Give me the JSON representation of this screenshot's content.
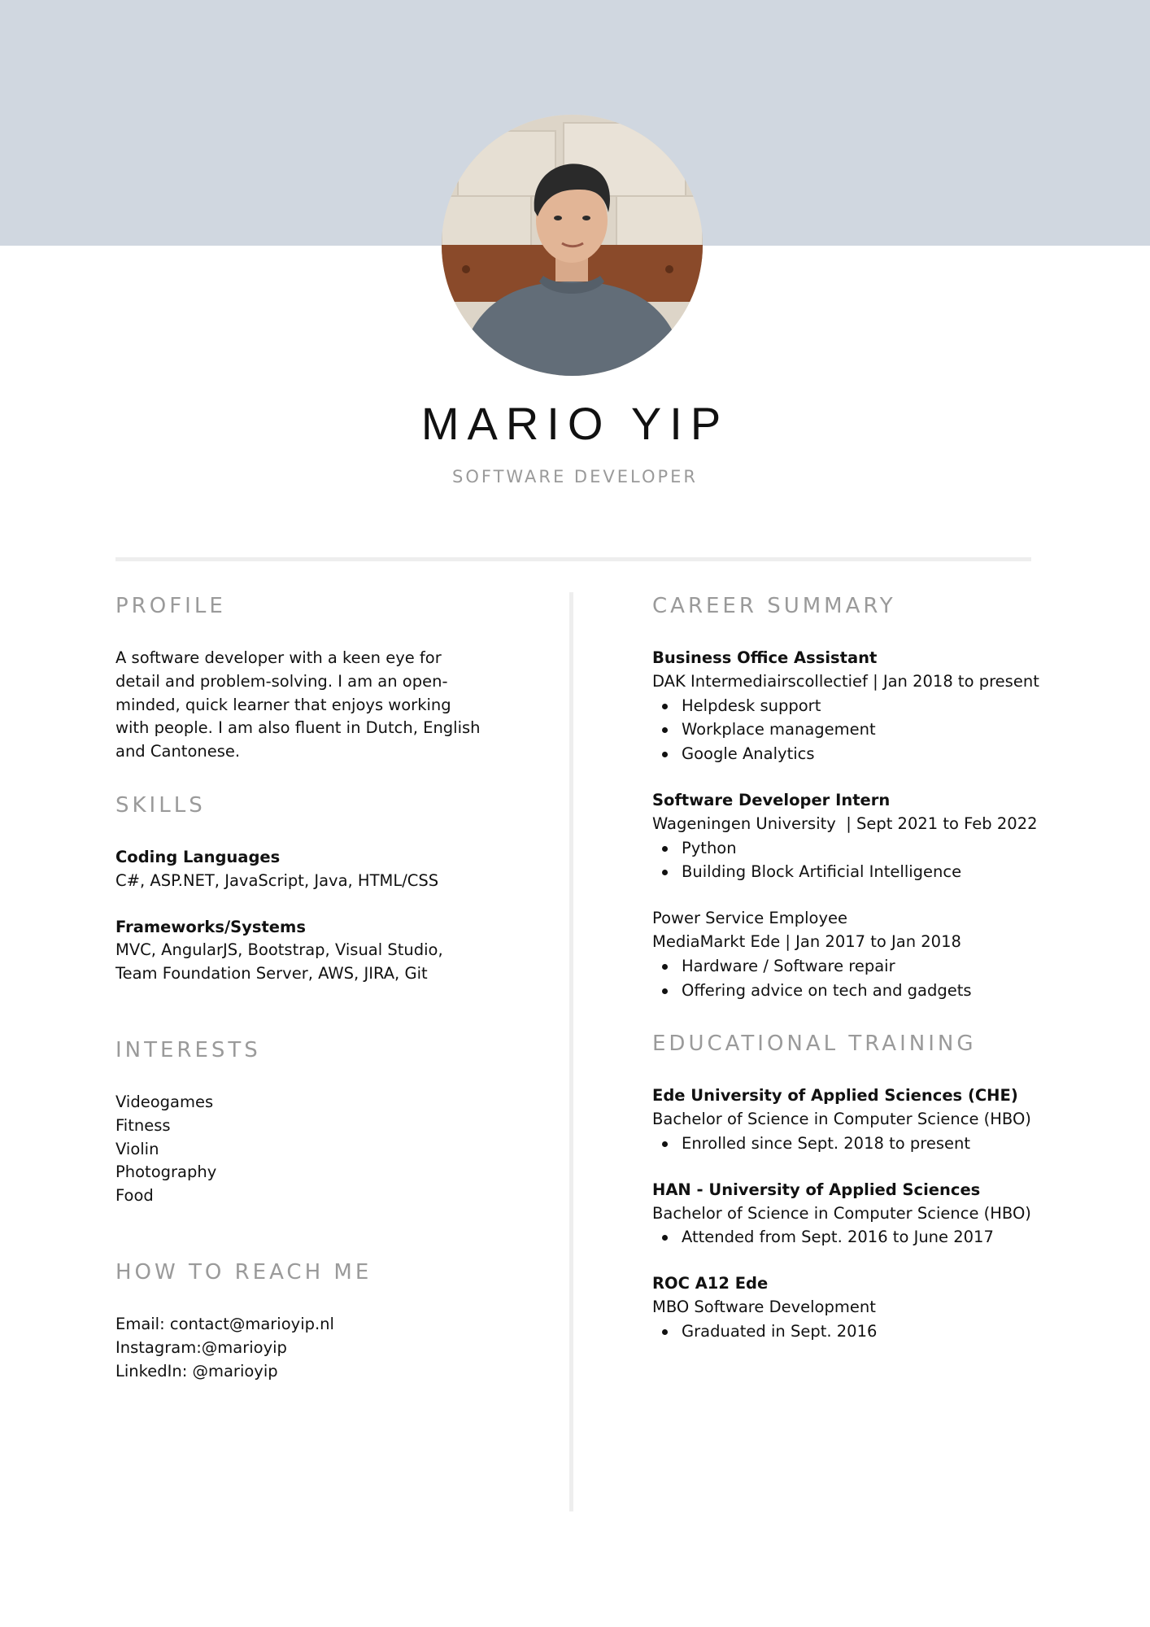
{
  "header": {
    "name": "MARIO YIP",
    "role": "SOFTWARE DEVELOPER",
    "band_color": "#d0d7e0"
  },
  "profile": {
    "title": "PROFILE",
    "lines": [
      "A software developer with a keen eye for",
      "detail and problem-solving. I am an open-",
      "minded, quick learner that enjoys working",
      "with people. I am also fluent in Dutch, English",
      "and Cantonese."
    ]
  },
  "skills": {
    "title": "SKILLS",
    "groups": [
      {
        "heading": "Coding Languages",
        "lines": [
          "C#, ASP.NET, JavaScript, Java, HTML/CSS"
        ]
      },
      {
        "heading": "Frameworks/Systems",
        "lines": [
          "MVC, AngularJS, Bootstrap, Visual Studio,",
          "Team Foundation Server, AWS, JIRA, Git"
        ]
      }
    ]
  },
  "interests": {
    "title": "INTERESTS",
    "items": [
      "Videogames",
      "Fitness",
      "Violin",
      "Photography",
      "Food"
    ]
  },
  "contact": {
    "title": "HOW TO REACH ME",
    "items": [
      "Email: contact@marioyip.nl",
      "Instagram:@marioyip",
      "LinkedIn: @marioyip"
    ]
  },
  "career": {
    "title": "CAREER SUMMARY",
    "jobs": [
      {
        "title": "Business Office Assistant",
        "company": "DAK Intermediairscollectief | Jan 2018 to present",
        "bullets": [
          "Helpdesk support",
          "Workplace management",
          "Google Analytics"
        ]
      },
      {
        "title": "Software Developer Intern",
        "company": "Wageningen University  | Sept 2021 to Feb 2022",
        "bullets": [
          "Python",
          "Building Block Artificial Intelligence"
        ]
      },
      {
        "title": "Power Service Employee",
        "company": "MediaMarkt Ede | Jan 2017 to Jan 2018",
        "bullets": [
          "Hardware / Software repair",
          "Offering advice on tech and gadgets"
        ]
      }
    ]
  },
  "education": {
    "title": "EDUCATIONAL TRAINING",
    "schools": [
      {
        "name": "Ede University of Applied Sciences (CHE)",
        "degree": "Bachelor of Science in Computer Science (HBO)",
        "bullets": [
          "Enrolled since Sept. 2018 to present"
        ]
      },
      {
        "name": "HAN - University of Applied Sciences",
        "degree": "Bachelor of Science in Computer Science (HBO)",
        "bullets": [
          "Attended from Sept. 2016 to June 2017"
        ]
      },
      {
        "name": "ROC A12 Ede",
        "degree": "MBO Software Development",
        "bullets": [
          "Graduated in Sept. 2016"
        ]
      }
    ]
  }
}
